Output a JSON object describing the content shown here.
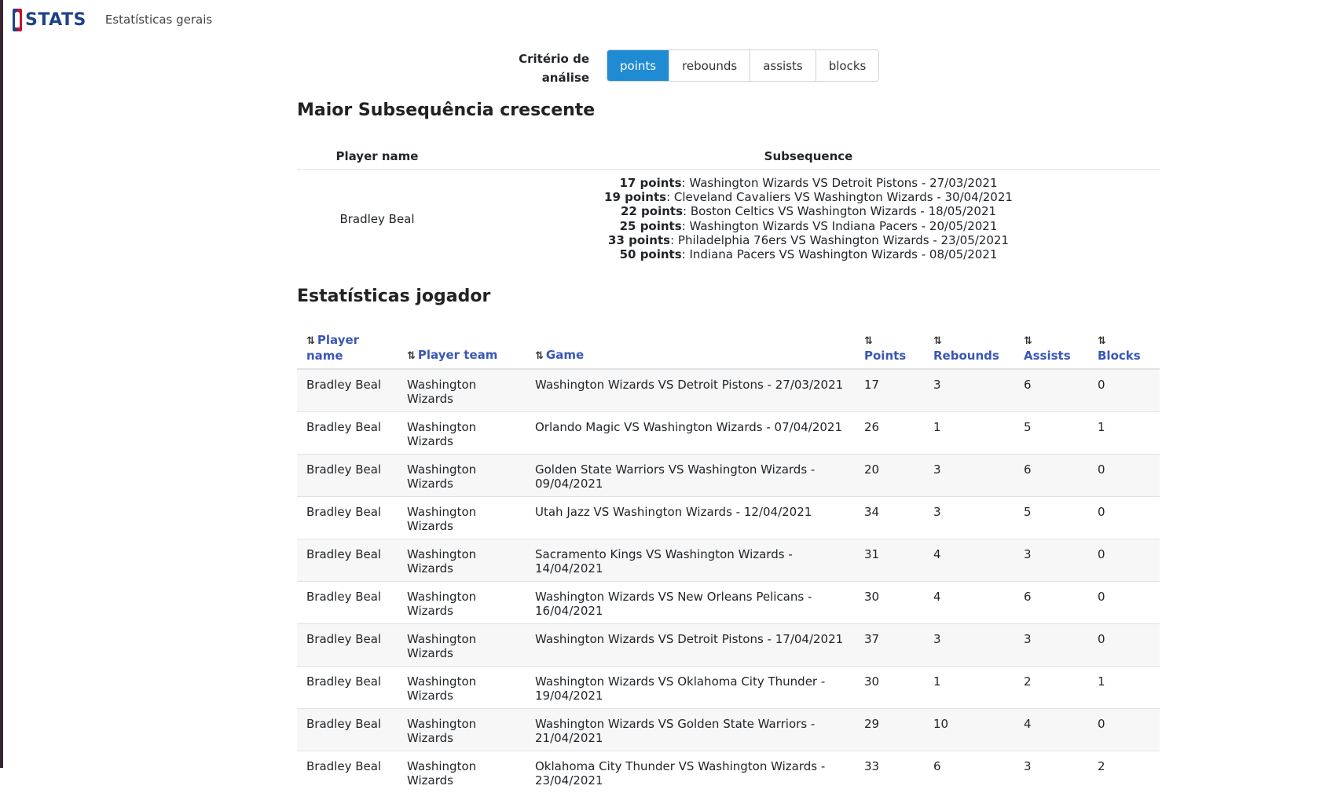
{
  "nav": {
    "logo_text": "STATS",
    "link": "Estatísticas gerais"
  },
  "criteria": {
    "label_line1": "Critério de",
    "label_line2": "análise",
    "options": [
      "points",
      "rebounds",
      "assists",
      "blocks"
    ],
    "selected": "points",
    "accent_color": "#1f8bd2"
  },
  "subsequence": {
    "title": "Maior Subsequência crescente",
    "col_player": "Player name",
    "col_subseq": "Subsequence",
    "player": "Bradley Beal",
    "items": [
      {
        "value": "17 points",
        "game": ": Washington Wizards VS Detroit Pistons - 27/03/2021"
      },
      {
        "value": "19 points",
        "game": ": Cleveland Cavaliers VS Washington Wizards - 30/04/2021"
      },
      {
        "value": "22 points",
        "game": ": Boston Celtics VS Washington Wizards - 18/05/2021"
      },
      {
        "value": "25 points",
        "game": ": Washington Wizards VS Indiana Pacers - 20/05/2021"
      },
      {
        "value": "33 points",
        "game": ": Philadelphia 76ers VS Washington Wizards - 23/05/2021"
      },
      {
        "value": "50 points",
        "game": ": Indiana Pacers VS Washington Wizards - 08/05/2021"
      }
    ]
  },
  "stats": {
    "title": "Estatísticas jogador",
    "columns": [
      "Player name",
      "Player team",
      "Game",
      "Points",
      "Rebounds",
      "Assists",
      "Blocks"
    ],
    "rows": [
      [
        "Bradley Beal",
        "Washington Wizards",
        "Washington Wizards VS Detroit Pistons - 27/03/2021",
        "17",
        "3",
        "6",
        "0"
      ],
      [
        "Bradley Beal",
        "Washington Wizards",
        "Orlando Magic VS Washington Wizards - 07/04/2021",
        "26",
        "1",
        "5",
        "1"
      ],
      [
        "Bradley Beal",
        "Washington Wizards",
        "Golden State Warriors VS Washington Wizards - 09/04/2021",
        "20",
        "3",
        "6",
        "0"
      ],
      [
        "Bradley Beal",
        "Washington Wizards",
        "Utah Jazz VS Washington Wizards - 12/04/2021",
        "34",
        "3",
        "5",
        "0"
      ],
      [
        "Bradley Beal",
        "Washington Wizards",
        "Sacramento Kings VS Washington Wizards - 14/04/2021",
        "31",
        "4",
        "3",
        "0"
      ],
      [
        "Bradley Beal",
        "Washington Wizards",
        "Washington Wizards VS New Orleans Pelicans - 16/04/2021",
        "30",
        "4",
        "6",
        "0"
      ],
      [
        "Bradley Beal",
        "Washington Wizards",
        "Washington Wizards VS Detroit Pistons - 17/04/2021",
        "37",
        "3",
        "3",
        "0"
      ],
      [
        "Bradley Beal",
        "Washington Wizards",
        "Washington Wizards VS Oklahoma City Thunder - 19/04/2021",
        "30",
        "1",
        "2",
        "1"
      ],
      [
        "Bradley Beal",
        "Washington Wizards",
        "Washington Wizards VS Golden State Warriors - 21/04/2021",
        "29",
        "10",
        "4",
        "0"
      ],
      [
        "Bradley Beal",
        "Washington Wizards",
        "Oklahoma City Thunder VS Washington Wizards - 23/04/2021",
        "33",
        "6",
        "3",
        "2"
      ]
    ]
  }
}
